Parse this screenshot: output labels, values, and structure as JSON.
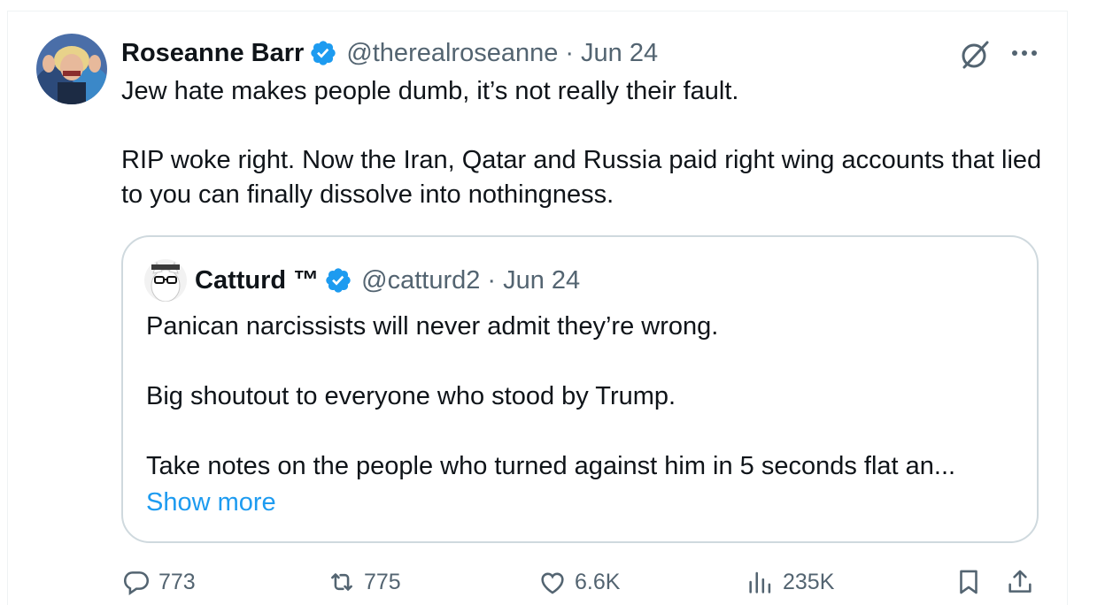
{
  "author": {
    "name": "Roseanne Barr",
    "handle": "@therealroseanne",
    "separator": "·",
    "date": "Jun 24"
  },
  "tweet": {
    "paragraphs": [
      "Jew hate makes people dumb, it’s not really their fault.",
      "RIP woke right. Now the Iran, Qatar and Russia paid right wing accounts that lied to you can finally dissolve into nothingness."
    ]
  },
  "quote": {
    "name": "Catturd ™",
    "handle": "@catturd2",
    "separator": "·",
    "date": "Jun 24",
    "paragraphs": [
      "Panican narcissists will never admit they’re wrong.",
      "Big shoutout to everyone who stood by Trump.",
      "Take notes on the people who turned against him in 5 seconds flat an..."
    ],
    "show_more": "Show more"
  },
  "actions": {
    "replies": "773",
    "reposts": "775",
    "likes": "6.6K",
    "views": "235K"
  },
  "icons": {
    "verified": "verified-badge-icon",
    "grok": "grok-icon",
    "more": "more-icon",
    "reply": "reply-icon",
    "repost": "repost-icon",
    "like": "like-icon",
    "views": "views-icon",
    "bookmark": "bookmark-icon",
    "share": "share-icon"
  },
  "colors": {
    "text": "#0f1419",
    "secondary": "#536471",
    "link": "#1d9bf0",
    "verified": "#1d9bf0",
    "border": "#cfd9de"
  }
}
